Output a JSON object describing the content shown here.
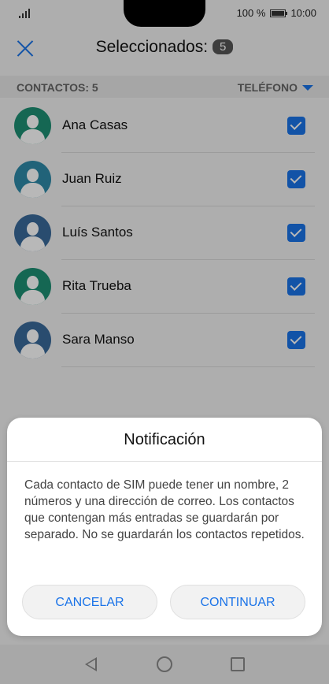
{
  "status_bar": {
    "battery_text": "100 %",
    "time": "10:00"
  },
  "header": {
    "title": "Seleccionados:",
    "selected_count": "5"
  },
  "subheader": {
    "count_label": "CONTACTOS: 5",
    "sort_label": "TELÉFONO"
  },
  "contacts": [
    {
      "name": "Ana Casas",
      "avatar_color": "#1e8f73",
      "checked": true
    },
    {
      "name": "Juan Ruiz",
      "avatar_color": "#2e8aa8",
      "checked": true
    },
    {
      "name": "Luís Santos",
      "avatar_color": "#3a6a9a",
      "checked": true
    },
    {
      "name": "Rita Trueba",
      "avatar_color": "#1e8f73",
      "checked": true
    },
    {
      "name": "Sara Manso",
      "avatar_color": "#3a6a9a",
      "checked": true
    }
  ],
  "dialog": {
    "title": "Notificación",
    "message": "Cada contacto de SIM puede tener un nombre, 2 números y una dirección de correo. Los contactos que contengan más entradas se guardarán por separado. No se guardarán los contactos repetidos.",
    "cancel_label": "CANCELAR",
    "continue_label": "CONTINUAR"
  },
  "colors": {
    "accent": "#1a73e8"
  }
}
